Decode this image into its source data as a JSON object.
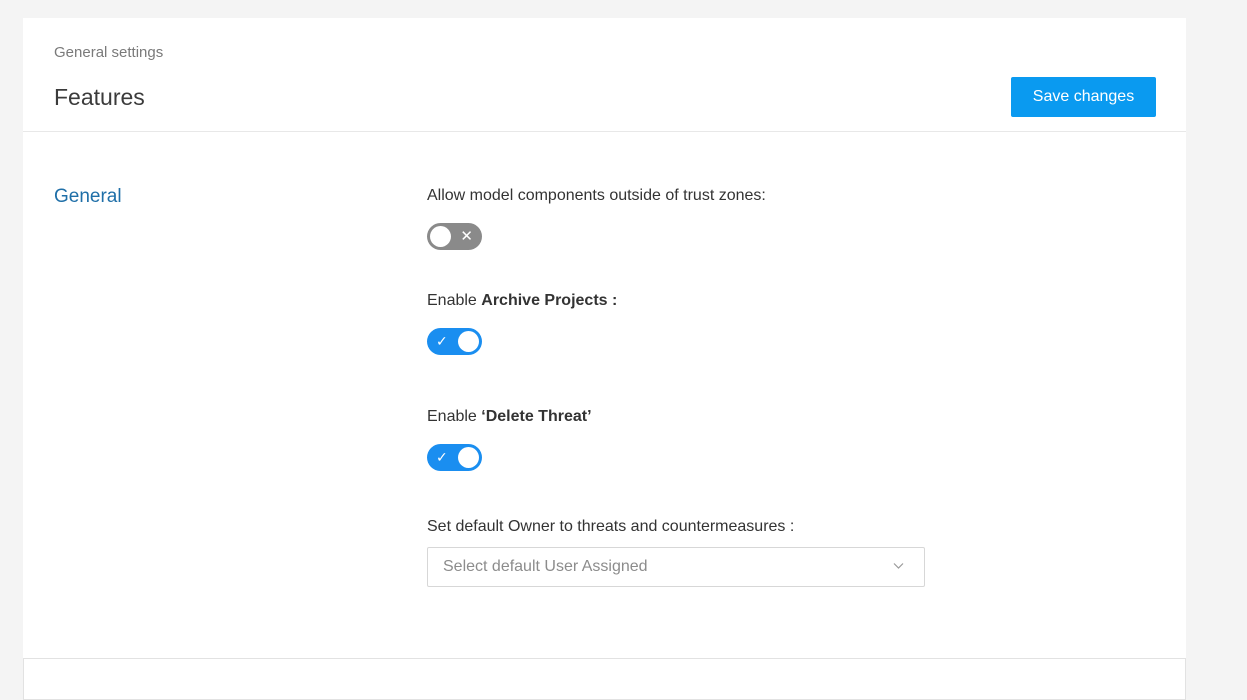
{
  "header": {
    "breadcrumb": "General settings",
    "title": "Features",
    "save_label": "Save changes"
  },
  "section": {
    "title": "General"
  },
  "settings": {
    "trust_zones": {
      "label": "Allow model components outside of trust zones:",
      "enabled": false,
      "off_mark": "✕"
    },
    "archive_projects": {
      "label_prefix": "Enable ",
      "label_bold": "Archive Projects :",
      "enabled": true,
      "on_mark": "✓"
    },
    "delete_threat": {
      "label_prefix": "Enable ",
      "label_bold": "‘Delete Threat’",
      "enabled": true,
      "on_mark": "✓"
    },
    "default_owner": {
      "label": "Set default Owner to threats and countermeasures :",
      "placeholder": "Select default User Assigned"
    }
  },
  "colors": {
    "accent": "#0a9af0",
    "toggle_on": "#1a8ef0",
    "toggle_off": "#8a8a8a",
    "section_title": "#1f6fa8"
  },
  "icons": {
    "dropdown": "chevron-down-icon",
    "check": "check-icon",
    "cross": "close-icon"
  }
}
